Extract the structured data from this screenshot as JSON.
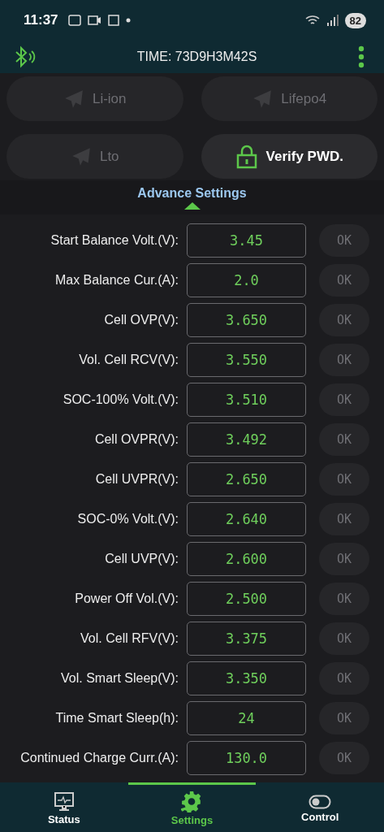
{
  "status_bar": {
    "time": "11:37",
    "battery": "82"
  },
  "header": {
    "title": "TIME: 73D9H3M42S"
  },
  "battery_types": [
    {
      "label": "Li-ion",
      "kind": "plane",
      "disabled": true
    },
    {
      "label": "Lifepo4",
      "kind": "plane",
      "disabled": true
    },
    {
      "label": "Lto",
      "kind": "plane",
      "disabled": true
    },
    {
      "label": "Verify PWD.",
      "kind": "lock",
      "disabled": false
    }
  ],
  "section": {
    "title": "Advance Settings",
    "expanded": true
  },
  "settings": [
    {
      "label": "Start Balance Volt.(V):",
      "value": "3.45",
      "button": "OK",
      "disabled": true
    },
    {
      "label": "Max Balance Cur.(A):",
      "value": "2.0",
      "button": "OK",
      "disabled": true
    },
    {
      "label": "Cell OVP(V):",
      "value": "3.650",
      "button": "OK",
      "disabled": true
    },
    {
      "label": "Vol. Cell RCV(V):",
      "value": "3.550",
      "button": "OK",
      "disabled": true
    },
    {
      "label": "SOC-100% Volt.(V):",
      "value": "3.510",
      "button": "OK",
      "disabled": true
    },
    {
      "label": "Cell OVPR(V):",
      "value": "3.492",
      "button": "OK",
      "disabled": true
    },
    {
      "label": "Cell UVPR(V):",
      "value": "2.650",
      "button": "OK",
      "disabled": true
    },
    {
      "label": "SOC-0% Volt.(V):",
      "value": "2.640",
      "button": "OK",
      "disabled": true
    },
    {
      "label": "Cell UVP(V):",
      "value": "2.600",
      "button": "OK",
      "disabled": true
    },
    {
      "label": "Power Off Vol.(V):",
      "value": "2.500",
      "button": "OK",
      "disabled": true
    },
    {
      "label": "Vol. Cell RFV(V):",
      "value": "3.375",
      "button": "OK",
      "disabled": true
    },
    {
      "label": "Vol. Smart Sleep(V):",
      "value": "3.350",
      "button": "OK",
      "disabled": true
    },
    {
      "label": "Time Smart Sleep(h):",
      "value": "24",
      "button": "OK",
      "disabled": true
    },
    {
      "label": "Continued Charge Curr.(A):",
      "value": "130.0",
      "button": "OK",
      "disabled": true
    }
  ],
  "nav": [
    {
      "label": "Status",
      "kind": "monitor",
      "selected": false
    },
    {
      "label": "Settings",
      "kind": "gear",
      "selected": true
    },
    {
      "label": "Control",
      "kind": "toggle",
      "selected": false
    }
  ]
}
